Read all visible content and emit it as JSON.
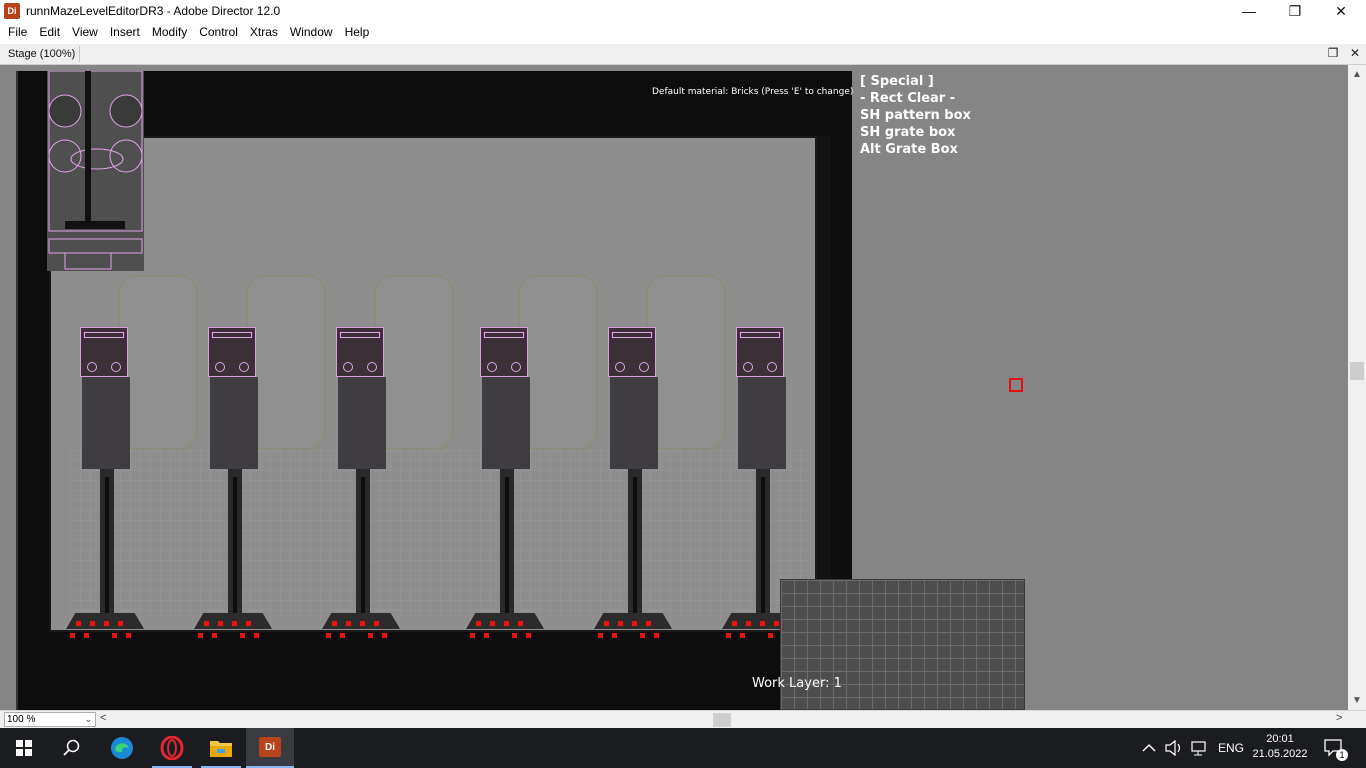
{
  "window": {
    "icon_label": "Di",
    "title": "runnMazeLevelEditorDR3 - Adobe Director 12.0",
    "controls": {
      "minimize": "—",
      "restore": "❐",
      "close": "✕"
    }
  },
  "menu": [
    "File",
    "Edit",
    "View",
    "Insert",
    "Modify",
    "Control",
    "Xtras",
    "Window",
    "Help"
  ],
  "stage": {
    "tab_label": "Stage (100%)",
    "ctl_restore": "❐",
    "ctl_close": "✕"
  },
  "level": {
    "material_text": "Default material: Bricks (Press 'E' to change)",
    "special_items": [
      "[ Special ]",
      "- Rect Clear -",
      "SH pattern box",
      "SH grate box",
      "Alt Grate Box"
    ],
    "work_layer": "Work Layer: 1",
    "pillar_count": 6
  },
  "status": {
    "zoom": "100 %",
    "zoom_chevron": "⌄",
    "scroll_left": "<",
    "scroll_right": ">",
    "scroll_up": "▲",
    "scroll_down": "▼"
  },
  "taskbar": {
    "lang": "ENG",
    "time": "20:01",
    "date": "21.05.2022",
    "notification_count": "1"
  },
  "colors": {
    "accent_red": "#ee1111",
    "pink_outline": "#e3a5e9",
    "stage_bg": "#858585"
  }
}
